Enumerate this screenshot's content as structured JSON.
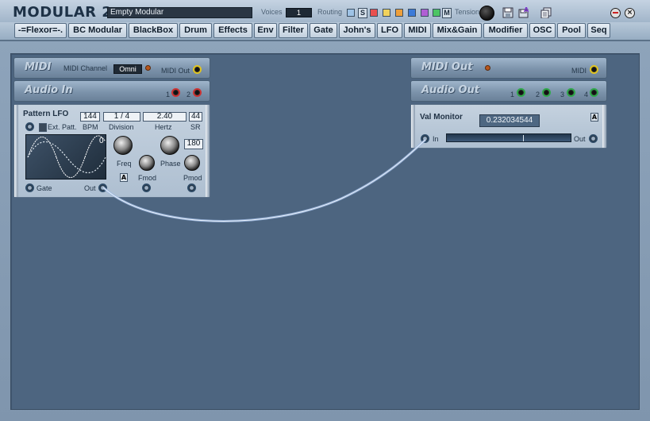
{
  "app": {
    "title": "MODULAR 2",
    "preset_name": "Empty Modular",
    "voices_label": "Voices",
    "voices_value": "1",
    "routing_label": "Routing",
    "routing_colors": [
      "#9fc3e6",
      "#e85050",
      "#f1d25c",
      "#ee9f3a",
      "#3c7ad8",
      "#b05fd4",
      "#4cc564"
    ],
    "s_label": "S",
    "m_label": "M",
    "tension_label": "Tension"
  },
  "categories": [
    "-=Flexor=-.",
    "BC Modular",
    "BlackBox",
    "Drum",
    "Effects",
    "Env",
    "Filter",
    "Gate",
    "John's",
    "LFO",
    "MIDI",
    "Mix&Gain",
    "Modifier",
    "OSC",
    "Pool",
    "Seq"
  ],
  "modules": {
    "midi": {
      "title": "MIDI",
      "channel_label": "MIDI Channel",
      "channel_value": "Omni",
      "out_label": "MIDI Out"
    },
    "audio_in": {
      "title": "Audio In",
      "port1": "1",
      "port2": "2"
    },
    "midi_out": {
      "title": "MIDI Out",
      "midi_label": "MIDI"
    },
    "audio_out": {
      "title": "Audio Out",
      "ports": [
        "1",
        "2",
        "3",
        "4"
      ]
    },
    "pattern_lfo": {
      "title": "Pattern LFO",
      "bpm_value": "144",
      "division_value": "1 /  4",
      "hertz_value": "2.40",
      "sr_value": "44",
      "ext_patt_label": "Ext. Patt.",
      "bpm_label": "BPM",
      "division_label": "Division",
      "hertz_label": "Hertz",
      "sr_label": "SR",
      "scope_value": "0",
      "phase_value": "180",
      "freq_label": "Freq",
      "phase_label": "Phase",
      "fmod_label": "Fmod",
      "pmod_label": "Pmod",
      "gate_label": "Gate",
      "out_label": "Out",
      "mini_btn_label": "A"
    },
    "val_monitor": {
      "title": "Val Monitor",
      "value": "0.232034544",
      "in_label": "In",
      "out_label": "Out",
      "mini_btn_label": "A"
    }
  }
}
